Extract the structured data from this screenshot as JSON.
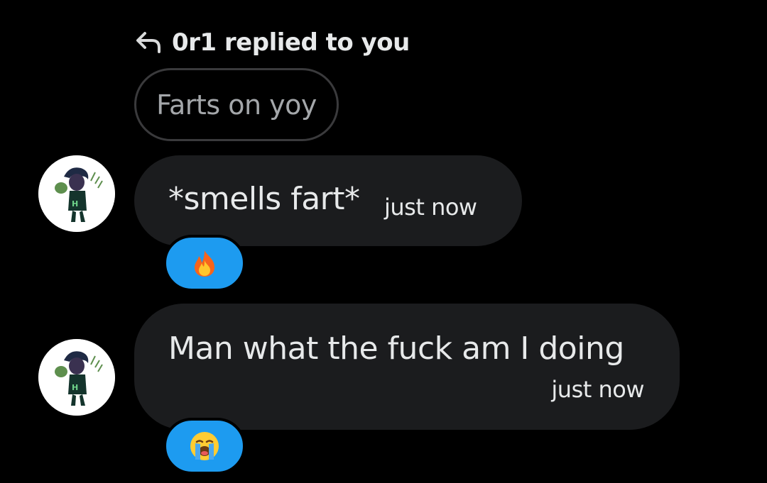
{
  "reply_header": {
    "text": "0r1 replied to you",
    "icon": "reply-arrow-icon"
  },
  "quoted_message": {
    "text": "Farts on yoy"
  },
  "messages": [
    {
      "text": "*smells fart*",
      "timestamp": "just now",
      "reaction": "fire-emoji",
      "avatar": "user-avatar"
    },
    {
      "text": "Man what the fuck am I doing",
      "timestamp": "just now",
      "reaction": "loudly-crying-emoji",
      "avatar": "user-avatar"
    }
  ],
  "colors": {
    "background": "#000000",
    "bubble": "#1b1c1e",
    "text": "#e7e9ea",
    "quoted_text": "#a4a7aa",
    "reaction": "#1d9bf0"
  }
}
